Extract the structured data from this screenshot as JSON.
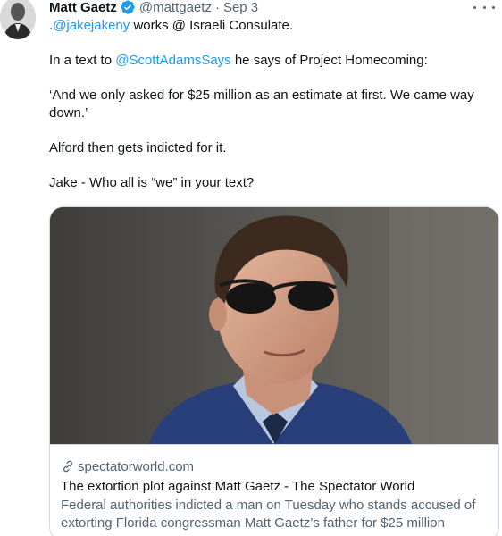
{
  "tweet": {
    "author": {
      "display_name": "Matt Gaetz",
      "handle": "@mattgaetz",
      "separator": "·",
      "date": "Sep 3",
      "verified": true
    },
    "more_icon": "more-horizontal-icon",
    "text": {
      "line1_prefix": ".",
      "line1_mention": "@jakejakeny",
      "line1_suffix": " works @ Israeli Consulate.",
      "line2_prefix": "In a text to ",
      "line2_mention": "@ScottAdamsSays",
      "line2_suffix": " he says of Project Homecoming:",
      "line3": "‘And we only asked for $25 million as an estimate at first. We came way down.’",
      "line4": "Alford then gets indicted for it.",
      "line5": "Jake - Who all is “we” in your text?"
    },
    "card": {
      "domain": "spectatorworld.com",
      "title": "The extortion plot against Matt Gaetz - The Spectator World",
      "description": "Federal authorities indicted a man on Tuesday who stands accused of extorting Florida congressman Matt Gaetz’s father for $25 million"
    }
  },
  "colors": {
    "link": "#1d9bf0",
    "secondary_text": "#536471",
    "primary_text": "#0f1419",
    "border": "#cfd9de"
  }
}
